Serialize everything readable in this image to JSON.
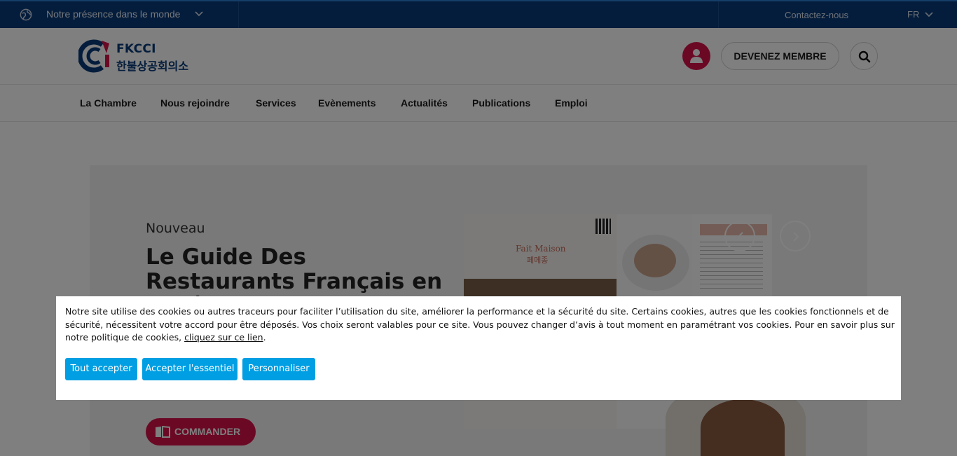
{
  "topbar": {
    "presence_label": "Notre présence dans le monde",
    "contact_label": "Contactez-nous",
    "language": "FR"
  },
  "header": {
    "logo_text_primary": "FKCCI",
    "logo_text_secondary": "한불상공회의소",
    "member_button": "DEVENEZ MEMBRE"
  },
  "nav": {
    "items": [
      {
        "label": "La Chambre"
      },
      {
        "label": "Nous rejoindre"
      },
      {
        "label": "Services"
      },
      {
        "label": "Evènements"
      },
      {
        "label": "Actualités"
      },
      {
        "label": "Publications"
      },
      {
        "label": "Emploi"
      }
    ]
  },
  "hero": {
    "kicker": "Nouveau",
    "title": "Le Guide Des Restaurants Français en Corée",
    "order_button": "COMMANDER",
    "book_label_fr": "Fait Maison",
    "book_label_ko": "페메종"
  },
  "cookie_banner": {
    "text_before_link": "Notre site utilise des cookies ou autres traceurs pour faciliter l’utilisation du site, améliorer la performance et la sécurité du site. Certains cookies, autres que les cookies fonctionnels et de sécurité, nécessitent votre accord pour être déposés. Vos choix seront valables pour ce site. Vous pouvez changer d’avis à tout moment en paramétrant vos cookies. Pour en savoir plus sur notre politique de cookies, ",
    "link_text": "cliquez sur ce lien",
    "text_after_link": ".",
    "accept_all": "Tout accepter",
    "accept_essential": "Accepter l'essentiel",
    "customize": "Personnaliser"
  },
  "colors": {
    "topbar_bg": "#0a3a78",
    "brand_red": "#d6124a",
    "cookie_button": "#009fe3"
  }
}
